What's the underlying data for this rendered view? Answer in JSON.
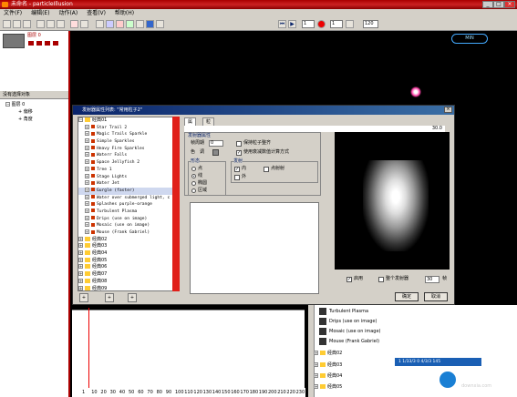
{
  "app": {
    "title": "未命名 - particleIllusion"
  },
  "window_controls": [
    "_",
    "□",
    "×"
  ],
  "menu": [
    "文件(F)",
    "编辑(E)",
    "动作(A)",
    "查看(V)",
    "帮助(H)"
  ],
  "toolbar": {
    "frame_field": "1",
    "emitter_field": "1",
    "fps_field": "120"
  },
  "left_panel": {
    "layer_name": "图层 0",
    "no_selection": "没有选择对象",
    "tree": [
      "图层 0",
      "偏移",
      "角度"
    ]
  },
  "stage": {
    "tab_label": "MIN"
  },
  "dialog": {
    "title": "发射器属性列表: \"常用粒子2\"",
    "close": "×",
    "tree_root": "经典01",
    "tree_items": [
      "Star Trail 2",
      "Magic Trails Sparkle",
      "Simple Sparkles",
      "Heavy Fire Sparkles",
      "Waterr Falls",
      "Space Jellyfish 2",
      "Tree 1",
      "Stage Lights",
      "Water Jet",
      "Gurgle (faster)",
      "Water over submerged light, c",
      "Splashes purple-orange",
      "Turbulent Plasma",
      "Drips (use on image)",
      "Mosaic (use on image)",
      "Mouse (Frank Gabriel)"
    ],
    "tree_folders": [
      "经典02",
      "经典03",
      "经典04",
      "经典05",
      "经典06",
      "经典07",
      "经典08",
      "经典09"
    ],
    "tree_buttons": [
      "+",
      "+",
      "+"
    ],
    "tabs": [
      "属性",
      "粒子"
    ],
    "fps": "30.0",
    "props": {
      "group_label": "发射器属性",
      "frames_label": "帧周期",
      "frames_value": "0",
      "color_label": "色　调",
      "keep_order_label": "保持粒子整齐",
      "attenuate_label": "使用衰减数值计算方式",
      "shape_group": "形态",
      "shape_options": [
        "点",
        "线",
        "椭圆",
        "区域"
      ],
      "shape_selected": 1,
      "emit_group": "发射",
      "emit_options": [
        "内",
        "外"
      ],
      "emit_checked": [
        true,
        false
      ],
      "point_emit_label": "点射射"
    },
    "preview": {
      "enable_label": "启用",
      "whole_label": "整个发射器",
      "count_value": "30",
      "unit": "帧"
    },
    "ok": "确定",
    "cancel": "取消"
  },
  "right_list": {
    "items": [
      "Turbulent Plasma",
      "Drips (use on image)",
      "Mosaic (use on image)",
      "Mouse (Frank Gabriel)"
    ],
    "folders": [
      "经典02",
      "经典03",
      "经典04",
      "经典05"
    ]
  },
  "status": {
    "text": "1 1/33/3   0 4/3/3   145"
  },
  "ruler_ticks": [
    "1",
    "10",
    "20",
    "30",
    "40",
    "50",
    "60",
    "70",
    "80",
    "90",
    "100",
    "110",
    "120",
    "130",
    "140",
    "150",
    "160",
    "170",
    "180",
    "190",
    "200",
    "210",
    "220",
    "230"
  ],
  "watermark": {
    "title": "当下软件园",
    "sub": "downxia.com"
  }
}
